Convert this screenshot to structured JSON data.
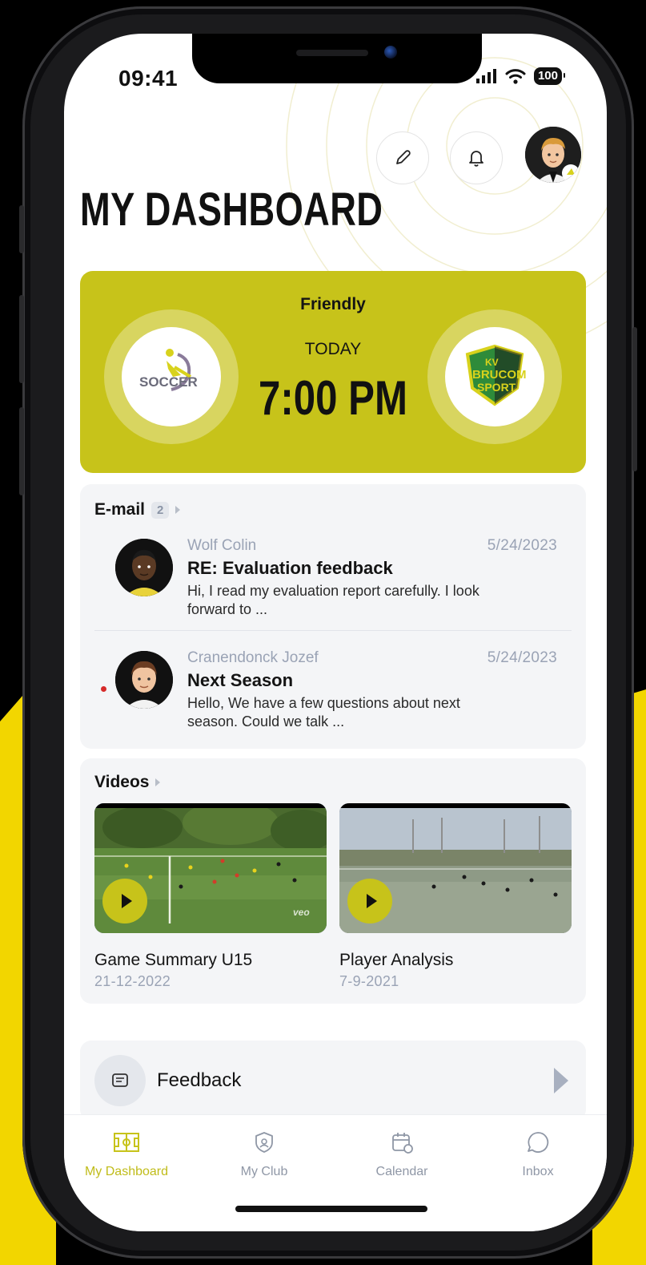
{
  "status": {
    "time": "09:41",
    "battery": "100"
  },
  "header": {
    "title": "MY DASHBOARD",
    "edit_icon": "pencil-icon",
    "notif_icon": "bell-icon"
  },
  "match": {
    "type": "Friendly",
    "day": "TODAY",
    "time": "7:00 PM",
    "home_logo_text": "SOCCER",
    "away_logo_text_1": "KV",
    "away_logo_text_2": "BRUCOM",
    "away_logo_text_3": "SPORT"
  },
  "email": {
    "title": "E-mail",
    "count": "2",
    "items": [
      {
        "sender": "Wolf Colin",
        "date": "5/24/2023",
        "subject": "RE: Evaluation feedback",
        "preview": "Hi, I read my evaluation report carefully. I look forward to ..."
      },
      {
        "sender": "Cranendonck Jozef",
        "date": "5/24/2023",
        "subject": "Next Season",
        "preview": "Hello, We have a few questions about next season. Could we talk ..."
      }
    ]
  },
  "videos": {
    "title": "Videos",
    "items": [
      {
        "title": "Game Summary U15",
        "date": "21-12-2022",
        "watermark": "veo"
      },
      {
        "title": "Player Analysis",
        "date": "7-9-2021"
      }
    ]
  },
  "feedback": {
    "label": "Feedback"
  },
  "tabs": [
    {
      "label": "My Dashboard",
      "icon": "field-icon"
    },
    {
      "label": "My Club",
      "icon": "club-shield-icon"
    },
    {
      "label": "Calendar",
      "icon": "calendar-icon"
    },
    {
      "label": "Inbox",
      "icon": "chat-bubble-icon"
    }
  ],
  "colors": {
    "accent": "#c7c31a",
    "background_accent": "#f2d600",
    "text": "#141414",
    "muted": "#9aa3b5",
    "card": "#f4f5f7",
    "unread": "#d62a2a"
  }
}
